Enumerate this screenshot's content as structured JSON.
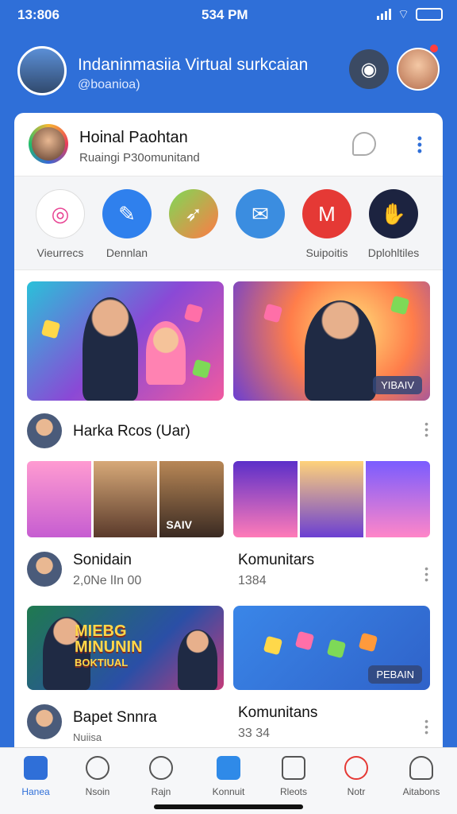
{
  "status": {
    "time_left": "13:806",
    "time_center": "534 PM"
  },
  "header": {
    "name": "Indaninmasiia Virtual surkcaian",
    "handle": "@boanioa)",
    "action_icon": "discord-icon",
    "accent": "#2f6fd8"
  },
  "profile": {
    "title": "Hoinal Paohtan",
    "subtitle": "Ruaingi P30omunitand"
  },
  "apps": [
    {
      "label": "Vieurrecs",
      "icon": "swirl-icon",
      "color": "#ffffff"
    },
    {
      "label": "Dennlan",
      "icon": "edit-icon",
      "color": "#2f80ed"
    },
    {
      "label": "",
      "icon": "rocket-icon",
      "color": "#ff7a45"
    },
    {
      "label": "",
      "icon": "mail-icon",
      "color": "#3b8de0"
    },
    {
      "label": "Suipoitis",
      "icon": "gmail-icon",
      "color": "#e53935"
    },
    {
      "label": "Dplohltiles",
      "icon": "hands-icon",
      "color": "#1c2340"
    }
  ],
  "feed": {
    "badge_top": "YIBAIV",
    "row1_label": "Harka Rcos (Uar)",
    "strip_badge": "SAIV",
    "sec_left": {
      "name": "Sonidain",
      "value": "2,0Ne lIn 00"
    },
    "sec_right": {
      "name": "Komunitars",
      "value": "1384"
    },
    "promo_text_1": "MIEBG",
    "promo_text_2": "MINUNIN",
    "promo_text_3": "BOKTIUAL",
    "badge_bottom": "PEBAIN",
    "row3_left": {
      "name": "Bapet Snnra",
      "value": "Nuiisa"
    },
    "row3_right": {
      "name": "Komunitans",
      "value": "33 34"
    }
  },
  "nav": [
    {
      "label": "Hanea",
      "icon": "home-icon",
      "active": true
    },
    {
      "label": "Nsoin",
      "icon": "search-icon"
    },
    {
      "label": "Rajn",
      "icon": "emoji-icon"
    },
    {
      "label": "Konnuit",
      "icon": "community-icon"
    },
    {
      "label": "Rleots",
      "icon": "photos-icon"
    },
    {
      "label": "Notr",
      "icon": "music-icon"
    },
    {
      "label": "Aitabons",
      "icon": "profile-icon"
    }
  ]
}
